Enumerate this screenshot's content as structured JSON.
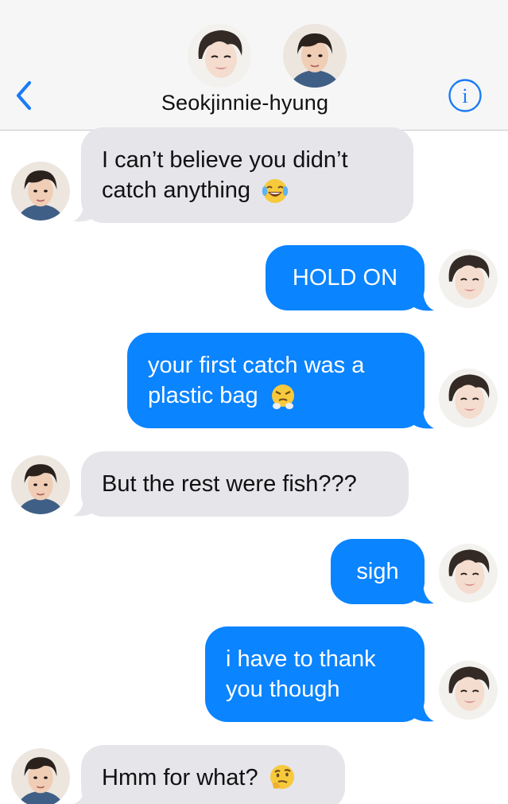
{
  "header": {
    "contact_name": "Seokjinnie-hyung",
    "back_icon": "chevron-left-icon",
    "info_icon": "info-icon",
    "accent_color": "#1a7cf5"
  },
  "colors": {
    "incoming_bubble": "#e5e5ea",
    "outgoing_bubble": "#0a84ff",
    "header_bg": "#f6f6f7"
  },
  "messages": [
    {
      "from": "contact",
      "text_line1": "I can’t believe you didn’t",
      "text_line2": "catch anything",
      "emoji": "face-with-tears-of-joy"
    },
    {
      "from": "me",
      "text": "HOLD ON"
    },
    {
      "from": "me",
      "text_line1": "your first catch was a",
      "text_line2": "plastic bag",
      "emoji": "face-with-steam-from-nose"
    },
    {
      "from": "contact",
      "text": "But the rest were fish???"
    },
    {
      "from": "me",
      "text": "sigh"
    },
    {
      "from": "me",
      "text_line1": "i have to thank",
      "text_line2": "you though"
    },
    {
      "from": "contact",
      "text": "Hmm for what?",
      "emoji": "thinking-face"
    }
  ]
}
